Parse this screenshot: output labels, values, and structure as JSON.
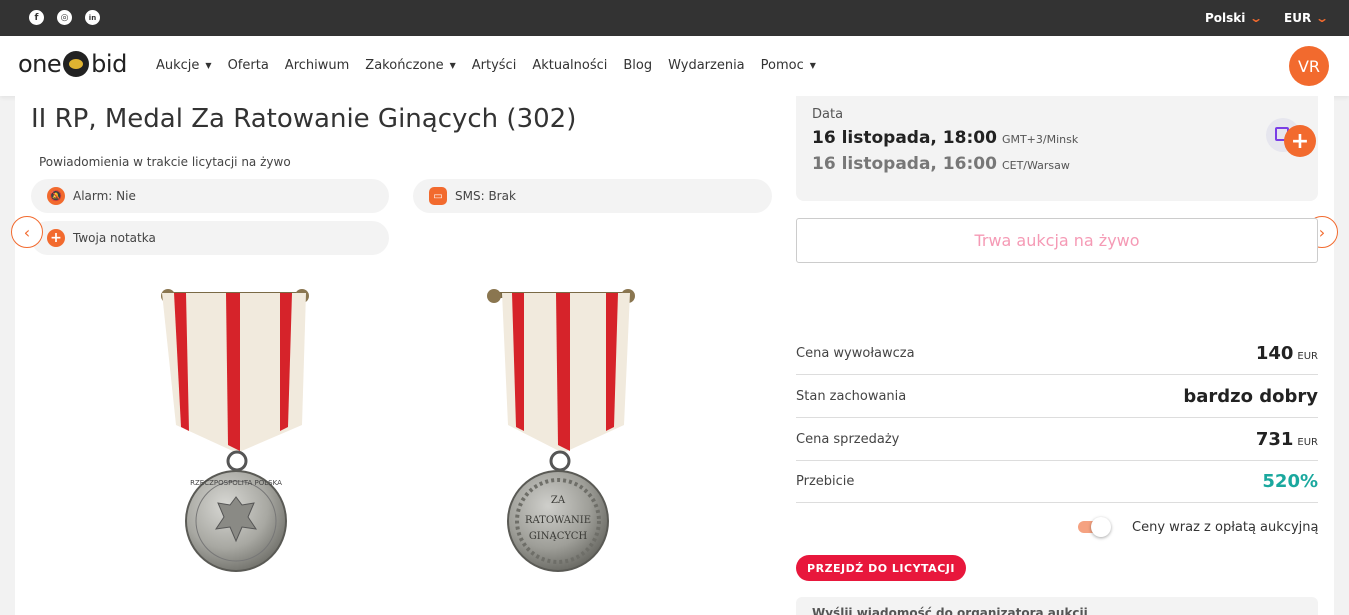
{
  "topbar": {
    "social": [
      {
        "icon": "facebook-icon",
        "glyph": "f"
      },
      {
        "icon": "instagram-icon",
        "glyph": "◎"
      },
      {
        "icon": "linkedin-icon",
        "glyph": "in"
      }
    ],
    "language": "Polski",
    "currency": "EUR",
    "accent": "#f26a2e"
  },
  "navbar": {
    "logo_left": "one",
    "logo_right": "bid",
    "items": [
      {
        "label": "Aukcje",
        "dropdown": true
      },
      {
        "label": "Oferta",
        "dropdown": false
      },
      {
        "label": "Archiwum",
        "dropdown": false
      },
      {
        "label": "Zakończone",
        "dropdown": true
      },
      {
        "label": "Artyści",
        "dropdown": false
      },
      {
        "label": "Aktualności",
        "dropdown": false
      },
      {
        "label": "Blog",
        "dropdown": false
      },
      {
        "label": "Wydarzenia",
        "dropdown": false
      },
      {
        "label": "Pomoc",
        "dropdown": true
      }
    ],
    "avatar": "VR"
  },
  "lot": {
    "title": "II RP, Medal Za Ratowanie Ginących (302)",
    "notifications_label": "Powiadomienia w trakcie licytacji na żywo",
    "alarm": "Alarm: Nie",
    "sms": "SMS: Brak",
    "note": "Twoja notatka",
    "medal_front_text": "RZECZPOSPOLITA POLSKA",
    "medal_back_text": [
      "ZA",
      "RATOWANIE",
      "GINĄCYCH"
    ]
  },
  "date": {
    "label": "Data",
    "primary": "16 listopada, 18:00",
    "primary_tz": "GMT+3/Minsk",
    "secondary": "16 listopada, 16:00",
    "secondary_tz": "CET/Warsaw"
  },
  "live_button": "Trwa aukcja na żywo",
  "details": [
    {
      "label": "Cena wywoławcza",
      "value": "140",
      "unit": "EUR"
    },
    {
      "label": "Stan zachowania",
      "value": "bardzo dobry",
      "unit": ""
    },
    {
      "label": "Cena sprzedaży",
      "value": "731",
      "unit": "EUR"
    },
    {
      "label": "Przebicie",
      "value": "520%",
      "unit": ""
    }
  ],
  "fee_toggle": {
    "label": "Ceny wraz z opłatą aukcyjną",
    "on": true
  },
  "bid_button": "PRZEJDŹ DO LICYTACJI",
  "message_box": "Wyślij wiadomość do organizatora aukcji"
}
